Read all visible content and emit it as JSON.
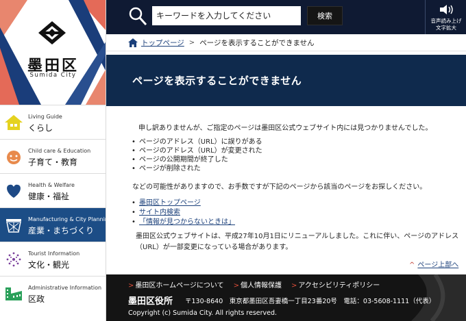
{
  "brand": {
    "name": "墨田区",
    "name_en": "Sumida City"
  },
  "sidebar": {
    "items": [
      {
        "en": "Living Guide",
        "jp": "くらし",
        "icon": "house-icon",
        "active": false
      },
      {
        "en": "Child care & Education",
        "jp": "子育て・教育",
        "icon": "child-face-icon",
        "active": false
      },
      {
        "en": "Health & Welfare",
        "jp": "健康・福祉",
        "icon": "heart-icon",
        "active": false
      },
      {
        "en": "Manufacturing & City Planning",
        "jp": "産業・まちづくり",
        "icon": "basket-icon",
        "active": true
      },
      {
        "en": "Tourist Information",
        "jp": "文化・観光",
        "icon": "fireworks-icon",
        "active": false
      },
      {
        "en": "Administrative Information",
        "jp": "区政",
        "icon": "building-icon",
        "active": false
      }
    ]
  },
  "header": {
    "search_placeholder": "キーワードを入力してください",
    "search_button": "検索",
    "voice_line1": "音声読み上げ",
    "voice_line2": "文字拡大"
  },
  "breadcrumb": {
    "home": "トップページ",
    "current": "ページを表示することができません"
  },
  "main": {
    "title": "ページを表示することができません",
    "apology": "申し訳ありませんが、ご指定のページは墨田区公式ウェブサイト内には見つかりませんでした。",
    "reasons": [
      "ページのアドレス（URL）に誤りがある",
      "ページのアドレス（URL）が変更された",
      "ページの公開期間が終了した",
      "ページが削除された"
    ],
    "possibility": "などの可能性がありますので、お手数ですが下記のページから該当のページをお探しください。",
    "links": [
      "墨田区トップページ",
      "サイト内検索",
      "「情報が見つからないときは」"
    ],
    "renewal": "墨田区公式ウェブサイトは、平成27年10月1日にリニューアルしました。これに伴い、ページのアドレス（URL）が一部変更になっている場合があります。",
    "page_top": "ページ上部へ"
  },
  "footer": {
    "links": [
      "墨田区ホームページについて",
      "個人情報保護",
      "アクセシビリティポリシー"
    ],
    "office": "墨田区役所",
    "address": "〒130-8640　東京都墨田区吾妻橋一丁目23番20号　電話：03-5608-1111（代表）",
    "copyright": "Copyright (c) Sumida City. All rights reserved."
  },
  "colors": {
    "header_bg": "#0f1a33",
    "title_band": "#0f2a4d",
    "active_nav": "#1c4d86",
    "link": "#1a3f7a",
    "accent_red": "#e04e3a"
  }
}
